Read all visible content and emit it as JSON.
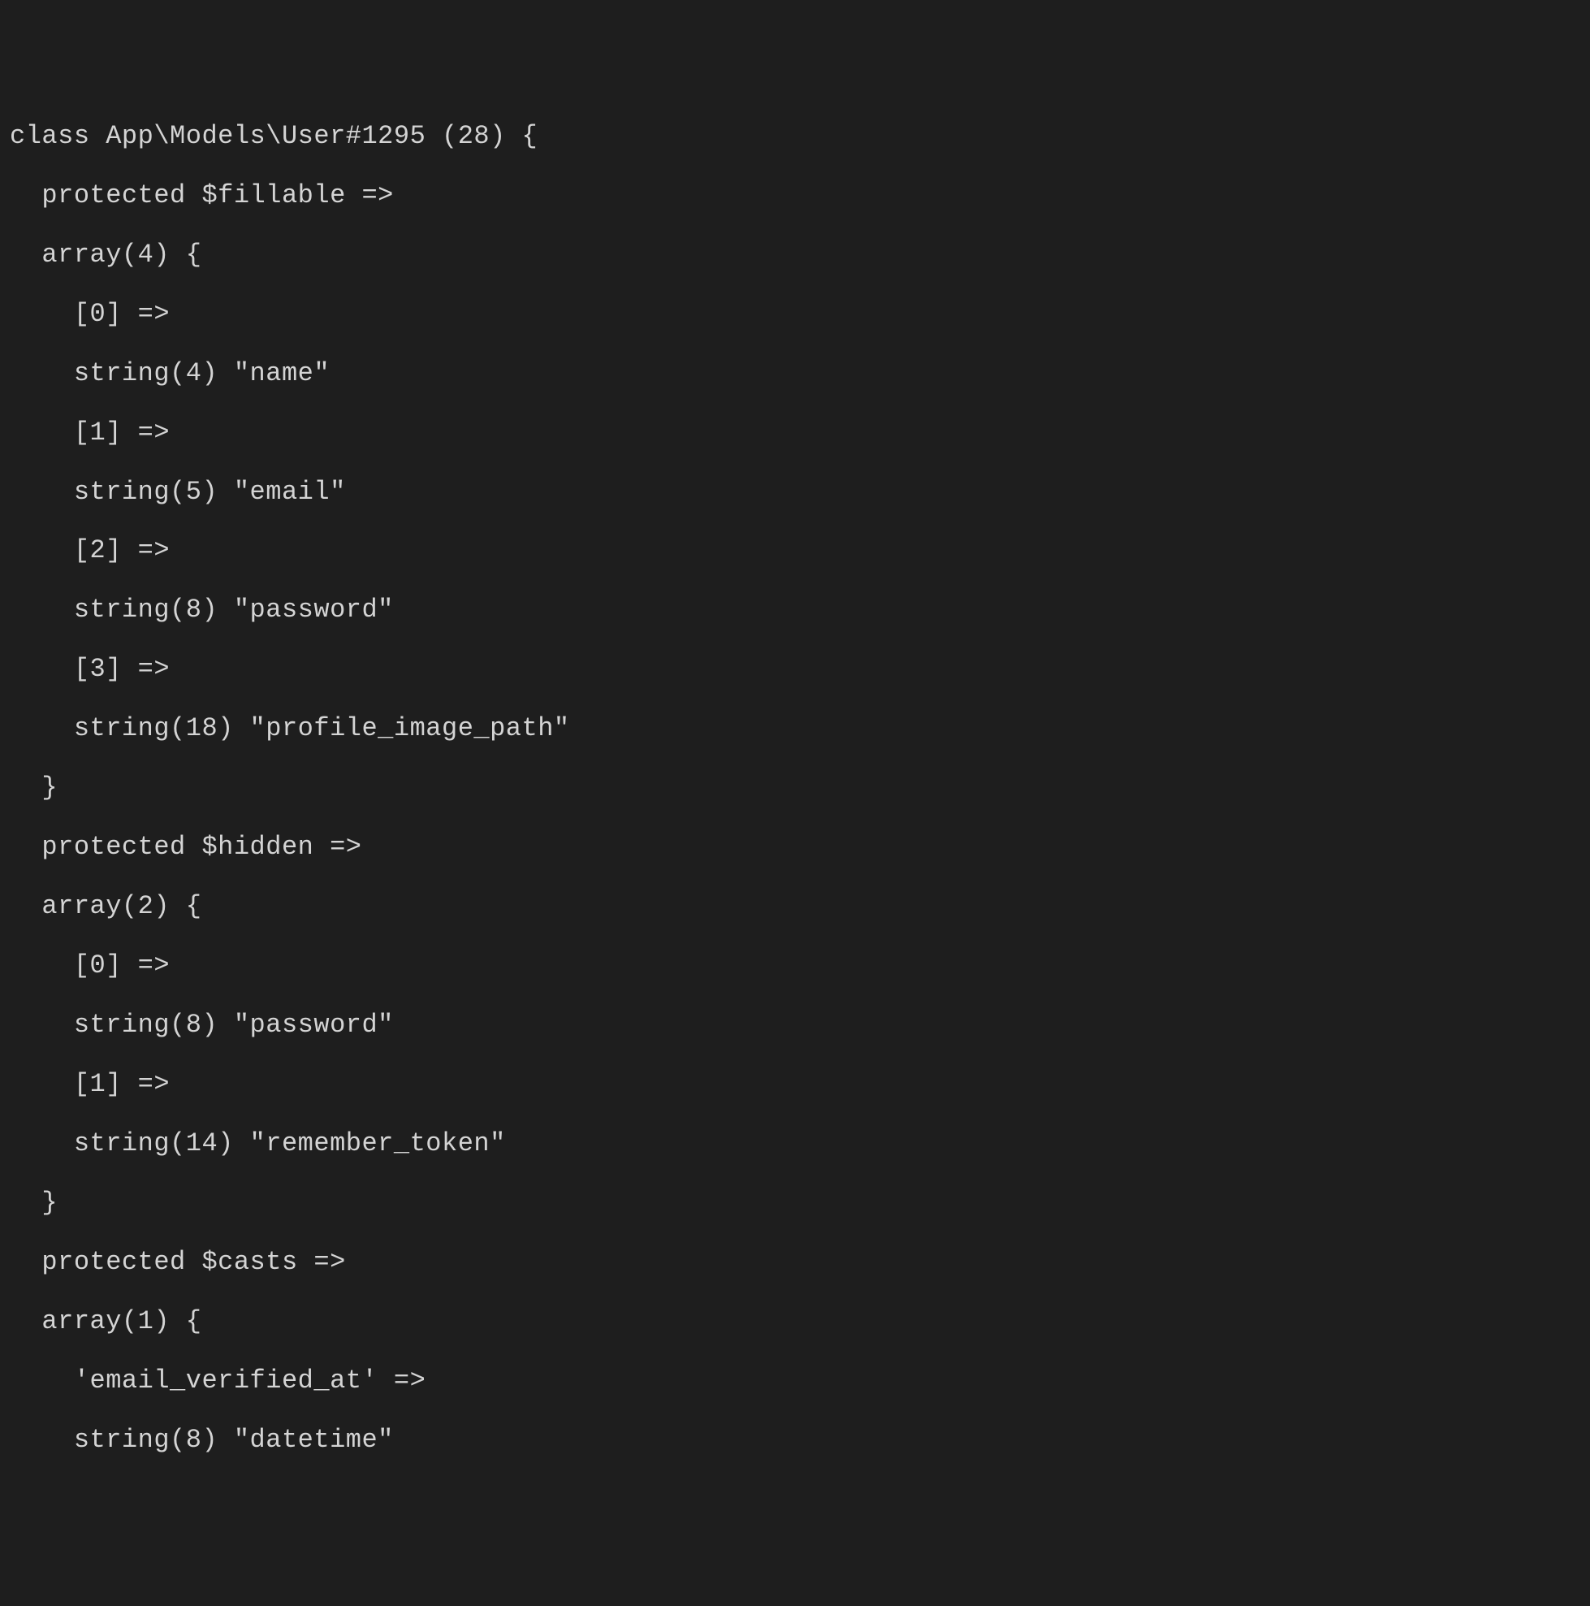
{
  "dump": {
    "class_header": "class App\\Models\\User#1295 (28) {",
    "fillable": {
      "label": "  protected $fillable =>",
      "array_open": "  array(4) {",
      "items": [
        {
          "index": "    [0] =>",
          "value": "    string(4) \"name\""
        },
        {
          "index": "    [1] =>",
          "value": "    string(5) \"email\""
        },
        {
          "index": "    [2] =>",
          "value": "    string(8) \"password\""
        },
        {
          "index": "    [3] =>",
          "value": "    string(18) \"profile_image_path\""
        }
      ],
      "array_close": "  }"
    },
    "hidden": {
      "label": "  protected $hidden =>",
      "array_open": "  array(2) {",
      "items": [
        {
          "index": "    [0] =>",
          "value": "    string(8) \"password\""
        },
        {
          "index": "    [1] =>",
          "value": "    string(14) \"remember_token\""
        }
      ],
      "array_close": "  }"
    },
    "casts": {
      "label": "  protected $casts =>",
      "array_open": "  array(1) {",
      "items": [
        {
          "index": "    'email_verified_at' =>",
          "value": "    string(8) \"datetime\""
        }
      ]
    }
  }
}
